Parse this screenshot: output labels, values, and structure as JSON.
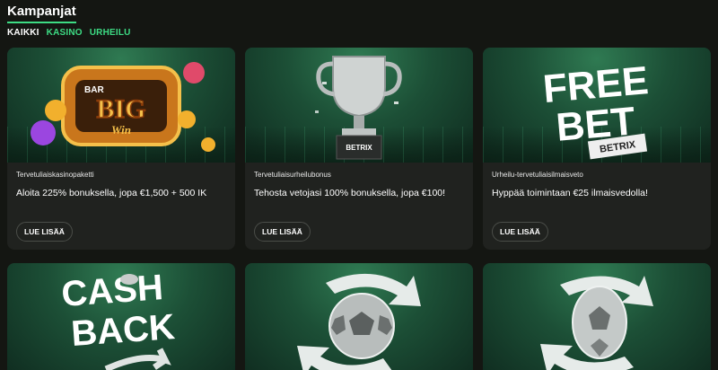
{
  "header": {
    "title": "Kampanjat"
  },
  "filters": [
    {
      "label": "KAIKKI"
    },
    {
      "label": "KASINO"
    },
    {
      "label": "URHEILU"
    }
  ],
  "cards": [
    {
      "category": "Tervetuliaiskasinopaketti",
      "headline": "Aloita 225% bonuksella, jopa €1,500 + 500 IK",
      "button": "LUE LISÄÄ",
      "image_icon": "big-win-slot-icon",
      "image_text": [
        "BAR",
        "BIG",
        "Win"
      ]
    },
    {
      "category": "Tervetuliaisurheilubonus",
      "headline": "Tehosta vetojasi 100% bonuksella, jopa €100!",
      "button": "LUE LISÄÄ",
      "image_icon": "trophy-icon",
      "image_text": [
        "BETRIX"
      ]
    },
    {
      "category": "Urheilu-tervetuliaisilmaisveto",
      "headline": "Hyppää toimintaan €25 ilmaisvedolla!",
      "button": "LUE LISÄÄ",
      "image_icon": "free-bet-ticket-icon",
      "image_text": [
        "FREE",
        "BET",
        "BETRIX"
      ]
    },
    {
      "image_icon": "cashback-icon",
      "image_text": [
        "CASH",
        "BACK"
      ]
    },
    {
      "image_icon": "football-refresh-icon"
    },
    {
      "image_icon": "football-refresh-icon"
    }
  ],
  "colors": {
    "accent": "#3ddc84",
    "background": "#141612",
    "card": "#20221f",
    "hero_green": "#1c4f36"
  }
}
